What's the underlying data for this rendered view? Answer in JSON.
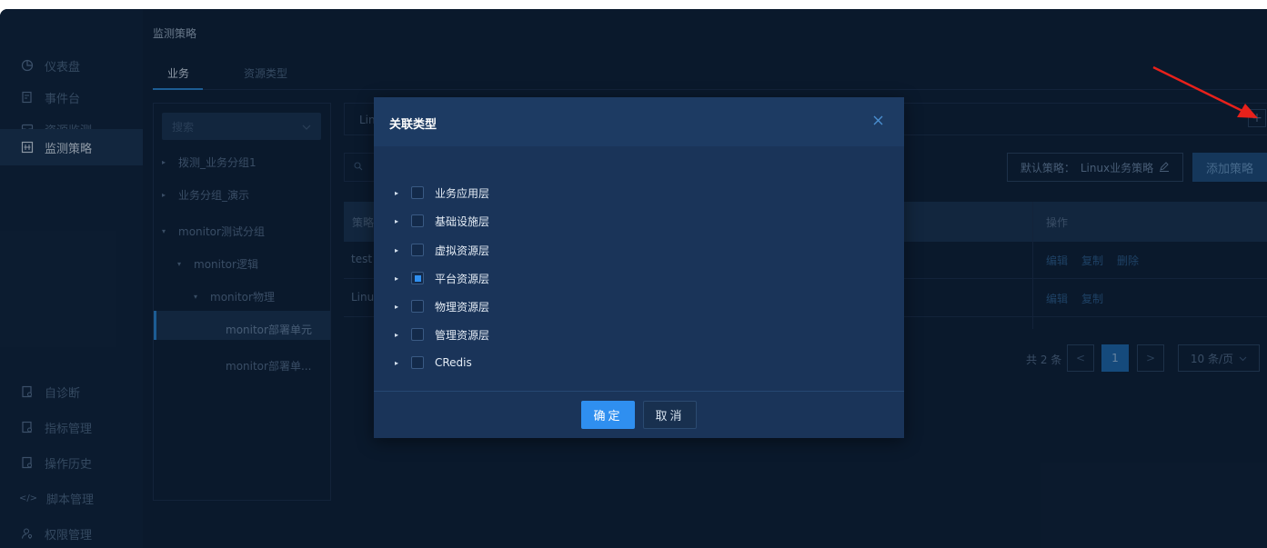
{
  "sidebar": {
    "top_items": [
      {
        "label": "仪表盘",
        "icon": "pie-chart-icon",
        "active": false
      },
      {
        "label": "事件台",
        "icon": "document-icon",
        "active": false
      },
      {
        "label": "资源监测",
        "icon": "inbox-icon",
        "active": false
      },
      {
        "label": "监测策略",
        "icon": "policy-icon",
        "active": true
      }
    ],
    "bottom_items": [
      {
        "label": "自诊断",
        "icon": "document-icon"
      },
      {
        "label": "指标管理",
        "icon": "document-icon"
      },
      {
        "label": "操作历史",
        "icon": "document-icon"
      },
      {
        "label": "脚本管理",
        "icon": "code-icon"
      },
      {
        "label": "权限管理",
        "icon": "user-key-icon"
      }
    ]
  },
  "header": {
    "title": "监测策略",
    "tabs": [
      {
        "label": "业务",
        "active": true
      },
      {
        "label": "资源类型",
        "active": false
      }
    ]
  },
  "tree": {
    "search_placeholder": "搜索",
    "nodes": [
      {
        "label": "拨测_业务分组1"
      },
      {
        "label": "业务分组_演示"
      },
      {
        "label": "monitor测试分组"
      },
      {
        "label": "monitor逻辑"
      },
      {
        "label": "monitor物理"
      },
      {
        "label": "monitor部署单元",
        "selected": true
      },
      {
        "label": "monitor部署单..."
      }
    ]
  },
  "content": {
    "top_bar_text": "Linu",
    "plus_label": "+",
    "default_policy": {
      "label": "默认策略：",
      "value": "Linux业务策略"
    },
    "add_policy_label": "添加策略",
    "table": {
      "headers": [
        "策略",
        "操作"
      ],
      "rows": [
        {
          "name": "test",
          "ops": [
            "编辑",
            "复制",
            "删除"
          ]
        },
        {
          "name": "Linu",
          "ops": [
            "编辑",
            "复制"
          ]
        }
      ]
    },
    "pagination": {
      "total_text": "共 2 条",
      "current_page": "1",
      "prev": "<",
      "next": ">",
      "page_size": "10 条/页"
    }
  },
  "modal": {
    "title": "关联类型",
    "close": "X",
    "options": [
      {
        "label": "业务应用层",
        "checked": false
      },
      {
        "label": "基础设施层",
        "checked": false
      },
      {
        "label": "虚拟资源层",
        "checked": false
      },
      {
        "label": "平台资源层",
        "checked": true
      },
      {
        "label": "物理资源层",
        "checked": false
      },
      {
        "label": "管理资源层",
        "checked": false
      },
      {
        "label": "CRedis",
        "checked": false
      }
    ],
    "ok_label": "确定",
    "cancel_label": "取消"
  },
  "colors": {
    "background": "#0f2138",
    "sidebar": "#10243d",
    "accent": "#2f8ff0",
    "modal": "#1a3459",
    "annotation_arrow": "#e8211b"
  }
}
